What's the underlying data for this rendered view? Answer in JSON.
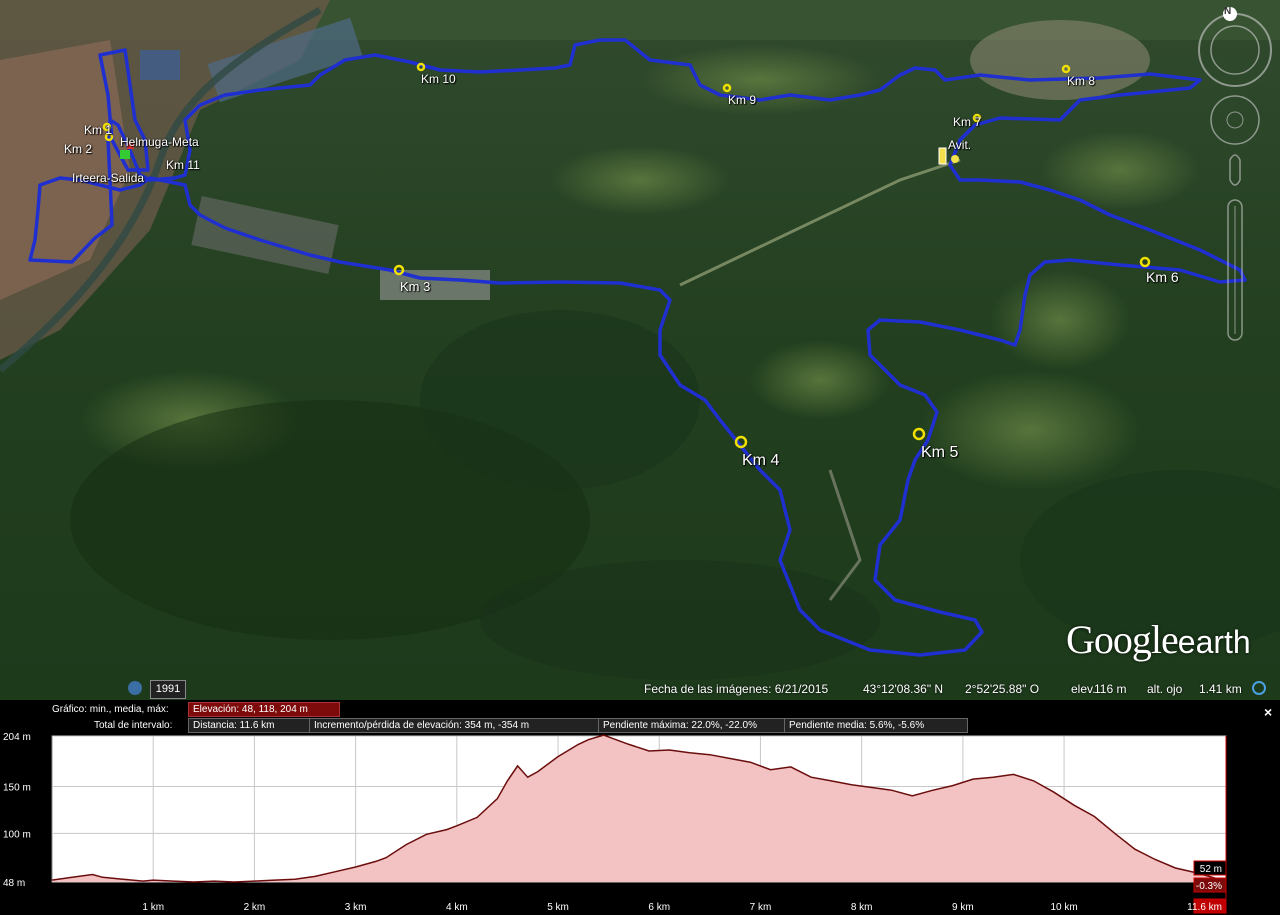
{
  "map": {
    "markers": {
      "km1": "Km 1",
      "km2": "Km 2",
      "km3": "Km 3",
      "km4": "Km 4",
      "km5": "Km 5",
      "km6": "Km 6",
      "km7": "Km 7",
      "km8": "Km 8",
      "km9": "Km 9",
      "km10": "Km 10",
      "km11": "Km 11",
      "finish": "Helmuga-Meta",
      "start": "Irteera-Salida",
      "aid": "Avit."
    },
    "route_color": "#1f2fd0",
    "logo_main": "Google",
    "logo_sub": "earth",
    "compass_label": "N"
  },
  "status": {
    "year": "1991",
    "imagery_date": "Fecha de las imágenes: 6/21/2015",
    "lat": "43°12'08.36\" N",
    "lon": "2°52'25.88\" O",
    "elev_label": "elev.",
    "elev_value": "116 m",
    "eye_alt_label": "alt. ojo",
    "eye_alt_value": "1.41 km"
  },
  "profile": {
    "graph_label": "Gráfico: min., media, máx:",
    "elevation_stats": "Elevación: 48, 118, 204 m",
    "interval_label": "Total de intervalo:",
    "distance": "Distancia: 11.6 km",
    "gain_loss": "Incremento/pérdida de elevación: 354 m, -354 m",
    "max_slope": "Pendiente máxima: 22.0%, -22.0%",
    "avg_slope": "Pendiente media: 5.6%, -5.6%",
    "cursor_elev": "52 m",
    "cursor_slope": "-0.3%",
    "cursor_dist": "11.6 km",
    "close": "×"
  },
  "chart_data": {
    "type": "area",
    "xlabel": "",
    "ylabel": "",
    "x_unit": "km",
    "y_unit": "m",
    "xlim": [
      0,
      11.6
    ],
    "ylim": [
      48,
      204
    ],
    "y_ticks": [
      {
        "v": 48,
        "label": "48 m"
      },
      {
        "v": 100,
        "label": "100 m"
      },
      {
        "v": 150,
        "label": "150 m"
      },
      {
        "v": 204,
        "label": "204 m"
      }
    ],
    "x_ticks": [
      {
        "v": 1,
        "label": "1 km"
      },
      {
        "v": 2,
        "label": "2 km"
      },
      {
        "v": 3,
        "label": "3 km"
      },
      {
        "v": 4,
        "label": "4 km"
      },
      {
        "v": 5,
        "label": "5 km"
      },
      {
        "v": 6,
        "label": "6 km"
      },
      {
        "v": 7,
        "label": "7 km"
      },
      {
        "v": 8,
        "label": "8 km"
      },
      {
        "v": 9,
        "label": "9 km"
      },
      {
        "v": 10,
        "label": "10 km"
      }
    ],
    "x": [
      0,
      0.2,
      0.4,
      0.5,
      0.7,
      0.9,
      1.0,
      1.2,
      1.4,
      1.6,
      1.8,
      2.0,
      2.2,
      2.4,
      2.6,
      2.8,
      3.0,
      3.2,
      3.3,
      3.5,
      3.7,
      3.9,
      4.0,
      4.2,
      4.4,
      4.5,
      4.6,
      4.7,
      4.8,
      5.0,
      5.2,
      5.3,
      5.45,
      5.5,
      5.7,
      5.9,
      6.1,
      6.3,
      6.5,
      6.7,
      6.9,
      7.1,
      7.3,
      7.5,
      7.7,
      7.9,
      8.1,
      8.3,
      8.5,
      8.7,
      8.9,
      9.1,
      9.3,
      9.5,
      9.7,
      9.9,
      10.1,
      10.3,
      10.5,
      10.7,
      10.9,
      11.1,
      11.3,
      11.5,
      11.6
    ],
    "series": [
      {
        "values": [
          50,
          53,
          56,
          53,
          51,
          49,
          50,
          49,
          48,
          49,
          48,
          49,
          50,
          51,
          54,
          59,
          64,
          70,
          74,
          88,
          99,
          104,
          108,
          117,
          137,
          156,
          172,
          160,
          166,
          182,
          195,
          200,
          205,
          203,
          195,
          188,
          189,
          186,
          184,
          180,
          176,
          168,
          171,
          160,
          156,
          152,
          149,
          146,
          140,
          146,
          151,
          158,
          160,
          163,
          156,
          144,
          130,
          118,
          100,
          83,
          72,
          63,
          58,
          52,
          52
        ]
      }
    ]
  }
}
